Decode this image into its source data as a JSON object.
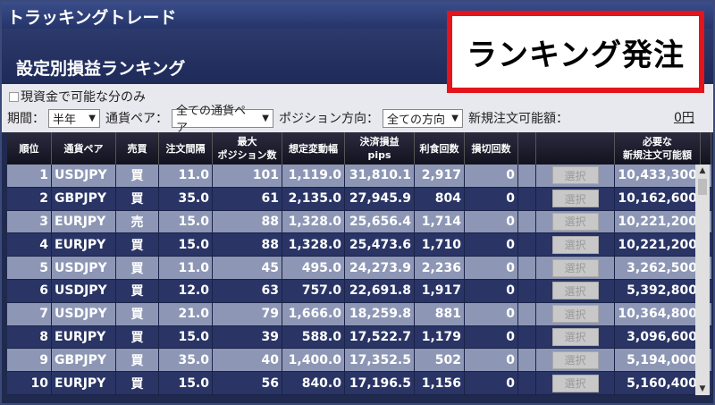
{
  "window": {
    "title": "トラッキングトレード"
  },
  "page": {
    "subtitle": "設定別損益ランキング"
  },
  "callout": {
    "text": "ランキング発注"
  },
  "cash_option": {
    "label": "現資金で可能な分のみ"
  },
  "filters": {
    "period_label": "期間：",
    "period_value": "半年",
    "currency_label": "通貨ペア：",
    "currency_value": "全ての通貨ペア",
    "direction_label": "ポジション方向：",
    "direction_value": "全ての方向",
    "order_amount_label": "新規注文可能額：",
    "order_amount_value": "0円"
  },
  "table": {
    "headers": {
      "rank": "順位",
      "pair": "通貨ペア",
      "side": "売買",
      "interval": "注文間隔",
      "max_pos_1": "最大",
      "max_pos_2": "ポジション数",
      "range": "想定変動幅",
      "pnl_1": "決済損益",
      "pnl_2": "pips",
      "profit_count": "利食回数",
      "loss_count": "損切回数",
      "required_1": "必要な",
      "required_2": "新規注文可能額"
    },
    "select_label": "選択",
    "rows": [
      {
        "rank": "1",
        "pair": "USDJPY",
        "side": "買",
        "interval": "11.0",
        "max_pos": "101",
        "range": "1,119.0",
        "pips": "31,810.1",
        "profit": "2,917",
        "loss": "0",
        "required": "10,433,300"
      },
      {
        "rank": "2",
        "pair": "GBPJPY",
        "side": "買",
        "interval": "35.0",
        "max_pos": "61",
        "range": "2,135.0",
        "pips": "27,945.9",
        "profit": "804",
        "loss": "0",
        "required": "10,162,600"
      },
      {
        "rank": "3",
        "pair": "EURJPY",
        "side": "売",
        "interval": "15.0",
        "max_pos": "88",
        "range": "1,328.0",
        "pips": "25,656.4",
        "profit": "1,714",
        "loss": "0",
        "required": "10,221,200"
      },
      {
        "rank": "4",
        "pair": "EURJPY",
        "side": "買",
        "interval": "15.0",
        "max_pos": "88",
        "range": "1,328.0",
        "pips": "25,473.6",
        "profit": "1,710",
        "loss": "0",
        "required": "10,221,200"
      },
      {
        "rank": "5",
        "pair": "USDJPY",
        "side": "買",
        "interval": "11.0",
        "max_pos": "45",
        "range": "495.0",
        "pips": "24,273.9",
        "profit": "2,236",
        "loss": "0",
        "required": "3,262,500"
      },
      {
        "rank": "6",
        "pair": "USDJPY",
        "side": "買",
        "interval": "12.0",
        "max_pos": "63",
        "range": "757.0",
        "pips": "22,691.8",
        "profit": "1,917",
        "loss": "0",
        "required": "5,392,800"
      },
      {
        "rank": "7",
        "pair": "USDJPY",
        "side": "買",
        "interval": "21.0",
        "max_pos": "79",
        "range": "1,666.0",
        "pips": "18,259.8",
        "profit": "881",
        "loss": "0",
        "required": "10,364,800"
      },
      {
        "rank": "8",
        "pair": "EURJPY",
        "side": "買",
        "interval": "15.0",
        "max_pos": "39",
        "range": "588.0",
        "pips": "17,522.7",
        "profit": "1,179",
        "loss": "0",
        "required": "3,096,600"
      },
      {
        "rank": "9",
        "pair": "GBPJPY",
        "side": "買",
        "interval": "35.0",
        "max_pos": "40",
        "range": "1,400.0",
        "pips": "17,352.5",
        "profit": "502",
        "loss": "0",
        "required": "5,194,000"
      },
      {
        "rank": "10",
        "pair": "EURJPY",
        "side": "買",
        "interval": "15.0",
        "max_pos": "56",
        "range": "840.0",
        "pips": "17,196.5",
        "profit": "1,156",
        "loss": "0",
        "required": "5,160,400"
      }
    ]
  },
  "colors": {
    "accent_red": "#e3141b",
    "header_navy": "#1f2a4e",
    "row_light": "#8d97b5",
    "row_dark": "#2a3566"
  }
}
